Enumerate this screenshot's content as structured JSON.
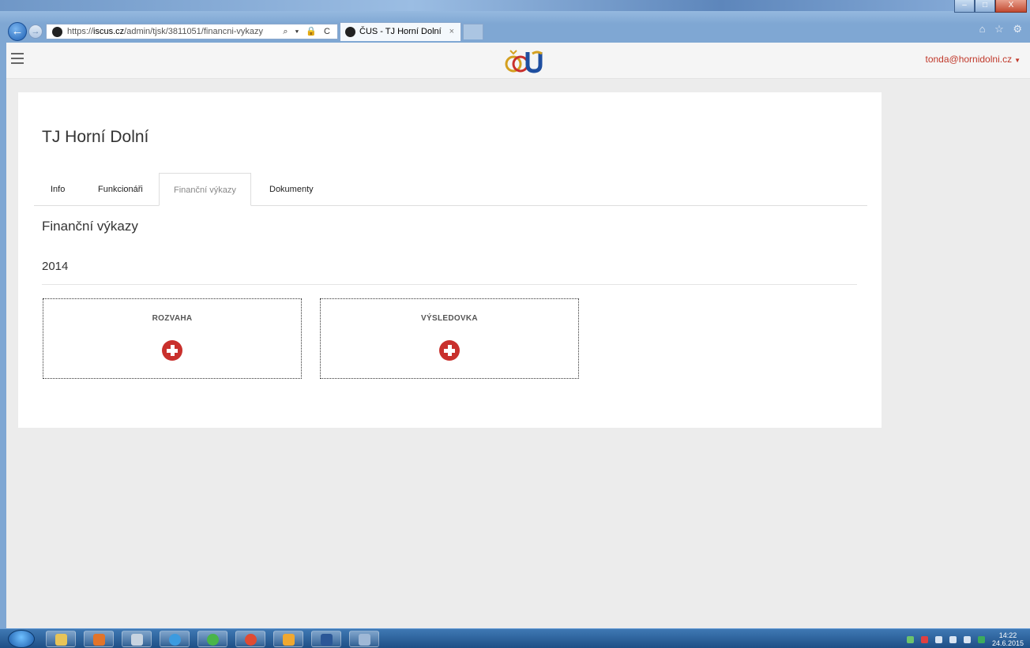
{
  "browser": {
    "url_protocol": "https://",
    "url_host": "iscus.cz",
    "url_path": "/admin/tjsk/3811051/financni-vykazy",
    "url_tools": "⌕ ▾ 🔒 C",
    "tab_title": "ČUS - TJ Horní Dolní",
    "tab_close": "×",
    "window_min": "–",
    "window_max": "□",
    "window_close": "X",
    "toolbar_icons": "⌂ ☆ ⚙",
    "back_glyph": "←",
    "forward_glyph": "→"
  },
  "header": {
    "user_email": "tonda@hornidolni.cz",
    "user_caret": "▼",
    "logo_name": "ČUS-logo"
  },
  "page": {
    "club_name": "TJ Horní Dolní",
    "tabs": [
      {
        "label": "Info"
      },
      {
        "label": "Funkcionáři"
      },
      {
        "label": "Finanční výkazy",
        "active": true
      },
      {
        "label": "Dokumenty"
      }
    ],
    "section_title": "Finanční výkazy",
    "year": "2014",
    "reports": [
      {
        "label": "ROZVAHA"
      },
      {
        "label": "VÝSLEDOVKA"
      }
    ]
  },
  "taskbar": {
    "time": "14:22",
    "date": "24.6.2015"
  },
  "colors": {
    "accent": "#c9302c",
    "user_link": "#c0392b",
    "background": "#ececec"
  }
}
